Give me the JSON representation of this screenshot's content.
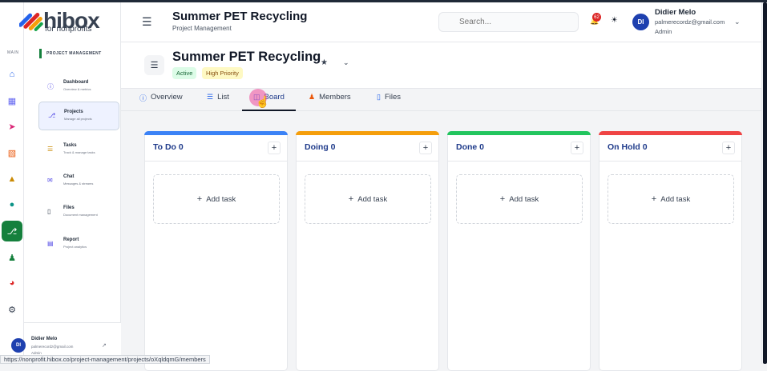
{
  "brand": {
    "name": "hibox",
    "tagline": "for nonprofits"
  },
  "rail": {
    "section_label": "MAIN",
    "items": [
      {
        "icon": "home-icon",
        "color": "#2563eb"
      },
      {
        "icon": "sitemap-icon",
        "color": "#6366f1"
      },
      {
        "icon": "rocket-icon",
        "color": "#db2777"
      },
      {
        "icon": "building-icon",
        "color": "#ea580c"
      },
      {
        "icon": "graduation-cap-icon",
        "color": "#ca8a04"
      },
      {
        "icon": "circle-icon",
        "color": "#0d9488"
      },
      {
        "icon": "project-diagram-icon",
        "color": "#ffffff",
        "active": true
      },
      {
        "icon": "users-icon",
        "color": "#15803d"
      },
      {
        "icon": "chart-pie-icon",
        "color": "#dc2626"
      },
      {
        "icon": "gear-icon",
        "color": "#374151"
      }
    ]
  },
  "sidebar": {
    "section_title": "PROJECT MANAGEMENT",
    "items": [
      {
        "label": "Dashboard",
        "desc": "Overview & metrics",
        "icon": "info-icon"
      },
      {
        "label": "Projects",
        "desc": "Manage all projects",
        "icon": "project-diagram-icon",
        "active": true
      },
      {
        "label": "Tasks",
        "desc": "Track & manage tasks",
        "icon": "list-icon"
      },
      {
        "label": "Chat",
        "desc": "Messages & streams",
        "icon": "chat-icon"
      },
      {
        "label": "Files",
        "desc": "Document management",
        "icon": "folder-icon"
      },
      {
        "label": "Report",
        "desc": "Project analytics",
        "icon": "bar-chart-icon"
      }
    ],
    "user": {
      "initials": "DI",
      "name": "Didier Melo",
      "email": "palmerecordz@gmail.com",
      "role": "Admin"
    }
  },
  "header": {
    "title": "Summer PET Recycling",
    "subtitle": "Project Management",
    "search_placeholder": "Search...",
    "notification_count": "62",
    "user": {
      "initials": "DI",
      "name": "Didier Melo",
      "email": "palmerecordz@gmail.com",
      "role": "Admin"
    }
  },
  "project": {
    "title": "Summer PET Recycling",
    "status": "Active",
    "priority": "High Priority"
  },
  "tabs": [
    {
      "label": "Overview",
      "icon": "info-circle-icon"
    },
    {
      "label": "List",
      "icon": "list-icon"
    },
    {
      "label": "Board",
      "icon": "columns-icon",
      "active": true
    },
    {
      "label": "Members",
      "icon": "users-icon"
    },
    {
      "label": "Files",
      "icon": "folder-open-icon"
    }
  ],
  "board": {
    "add_task_label": "Add task",
    "columns": [
      {
        "title": "To Do 0",
        "color": "#3b82f6"
      },
      {
        "title": "Doing 0",
        "color": "#f59e0b"
      },
      {
        "title": "Done 0",
        "color": "#22c55e"
      },
      {
        "title": "On Hold 0",
        "color": "#ef4444"
      }
    ]
  },
  "status_bar_url": "https://nonprofit.hibox.co/project-management/projects/oXqldqmG/members"
}
